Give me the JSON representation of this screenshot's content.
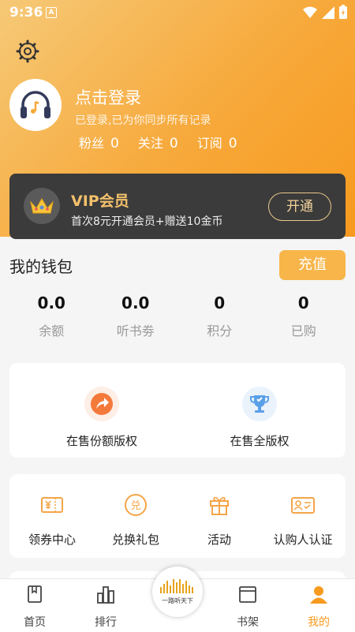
{
  "status": {
    "time": "9:36",
    "notification_glyph": "A"
  },
  "profile": {
    "title": "点击登录",
    "subtitle": "已登录,已为你同步所有记录",
    "stats": [
      {
        "label": "粉丝",
        "value": "0"
      },
      {
        "label": "关注",
        "value": "0"
      },
      {
        "label": "订阅",
        "value": "0"
      }
    ]
  },
  "vip": {
    "title": "VIP会员",
    "subtitle": "首次8元开通会员+赠送10金币",
    "button": "开通"
  },
  "wallet": {
    "title": "我的钱包",
    "recharge": "充值",
    "items": [
      {
        "value": "0.0",
        "label": "余额"
      },
      {
        "value": "0.0",
        "label": "听书劵"
      },
      {
        "value": "0",
        "label": "积分"
      },
      {
        "value": "0",
        "label": "已购"
      }
    ]
  },
  "features": [
    {
      "label": "在售份额版权",
      "icon": "share-arrow-icon",
      "color": "#f47a3c"
    },
    {
      "label": "在售全版权",
      "icon": "trophy-icon",
      "color": "#5aa0e8"
    }
  ],
  "tools": [
    {
      "label": "领券中心",
      "icon": "coupon-icon"
    },
    {
      "label": "兑换礼包",
      "icon": "exchange-icon"
    },
    {
      "label": "活动",
      "icon": "gift-icon"
    },
    {
      "label": "认购人认证",
      "icon": "id-card-icon"
    }
  ],
  "nav": [
    {
      "label": "首页",
      "icon": "home-book-icon"
    },
    {
      "label": "排行",
      "icon": "ranking-icon"
    },
    {
      "label": "书架",
      "icon": "bookshelf-icon"
    },
    {
      "label": "我的",
      "icon": "person-icon"
    }
  ],
  "logo_text": "一路听天下",
  "colors": {
    "accent": "#f79a1e",
    "vip_bg": "#3b3b3b",
    "vip_gold": "#f2c06b",
    "recharge": "#f7b54a"
  }
}
